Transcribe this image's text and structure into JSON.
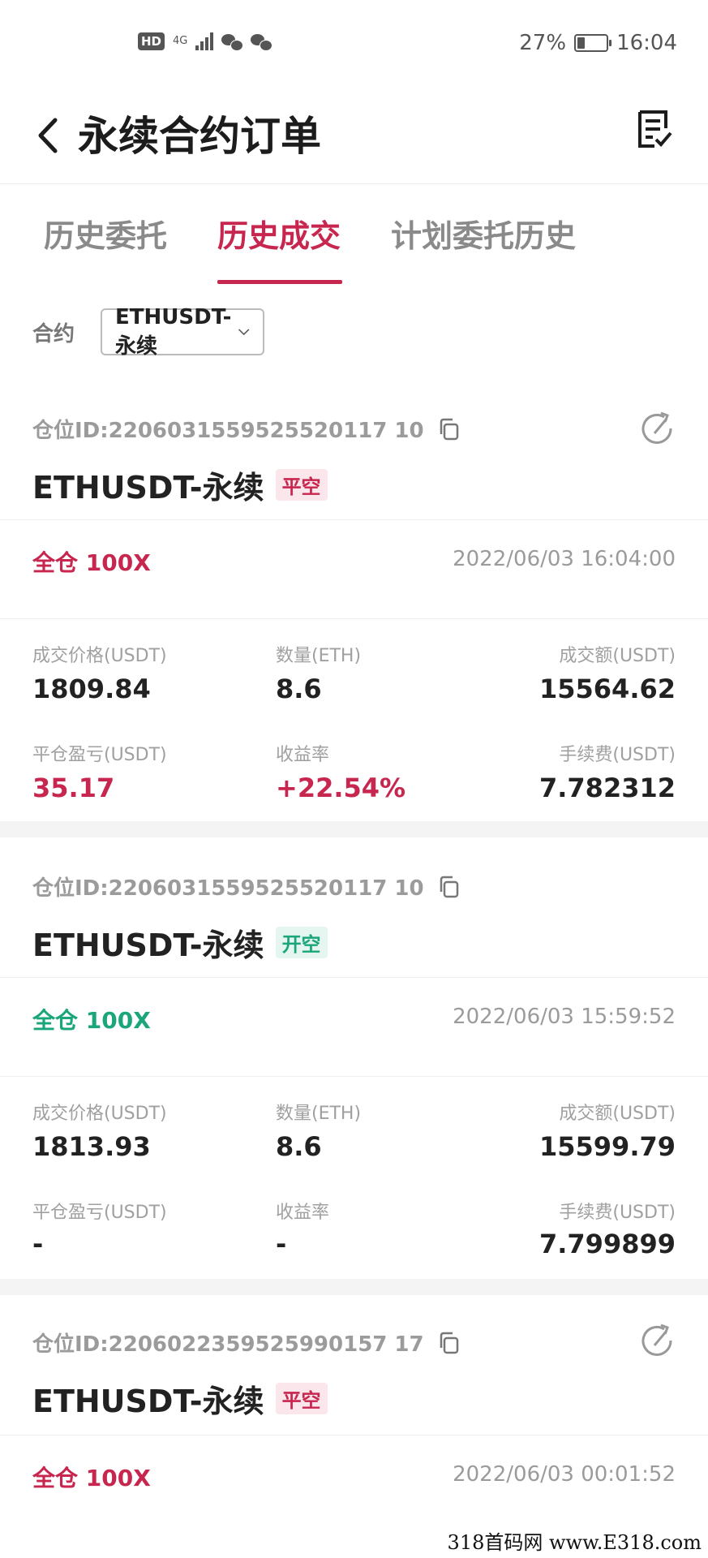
{
  "status_bar": {
    "hd": "HD",
    "net": "4G",
    "battery": "27%",
    "battery_level": 0.27,
    "time": "16:04"
  },
  "header": {
    "title": "永续合约订单",
    "back_icon": "chevron-left-icon",
    "orders_icon": "document-check-icon"
  },
  "tabs": [
    {
      "label": "历史委托",
      "active": false
    },
    {
      "label": "历史成交",
      "active": true
    },
    {
      "label": "计划委托历史",
      "active": false
    }
  ],
  "filter": {
    "label": "合约",
    "selected": "ETHUSDT-永续"
  },
  "colors": {
    "accent": "#c7264f",
    "profit_green": "#1aa67a",
    "muted": "#9b9b9b"
  },
  "orders": [
    {
      "position_id": "仓位ID:2206031559525520117 10",
      "pair": "ETHUSDT-永续",
      "side": "平空",
      "mode": "全仓 100X",
      "time": "2022/06/03 16:04:00",
      "price_label": "成交价格(USDT)",
      "price": "1809.84",
      "qty_label": "数量(ETH)",
      "qty": "8.6",
      "amount_label": "成交额(USDT)",
      "amount": "15564.62",
      "pnl_label": "平仓盈亏(USDT)",
      "pnl": "35.17",
      "roi_label": "收益率",
      "roi": "+22.54%",
      "fee_label": "手续费(USDT)",
      "fee": "7.782312"
    },
    {
      "position_id": "仓位ID:2206031559525520117 10",
      "pair": "ETHUSDT-永续",
      "side": "开空",
      "mode": "全仓 100X",
      "time": "2022/06/03 15:59:52",
      "price_label": "成交价格(USDT)",
      "price": "1813.93",
      "qty_label": "数量(ETH)",
      "qty": "8.6",
      "amount_label": "成交额(USDT)",
      "amount": "15599.79",
      "pnl_label": "平仓盈亏(USDT)",
      "pnl": "-",
      "roi_label": "收益率",
      "roi": "-",
      "fee_label": "手续费(USDT)",
      "fee": "7.799899"
    },
    {
      "position_id": "仓位ID:2206022359525990157 17",
      "pair": "ETHUSDT-永续",
      "side": "平空",
      "mode": "全仓 100X",
      "time": "2022/06/03 00:01:52"
    }
  ],
  "watermark": "318首码网 www.E318.com"
}
